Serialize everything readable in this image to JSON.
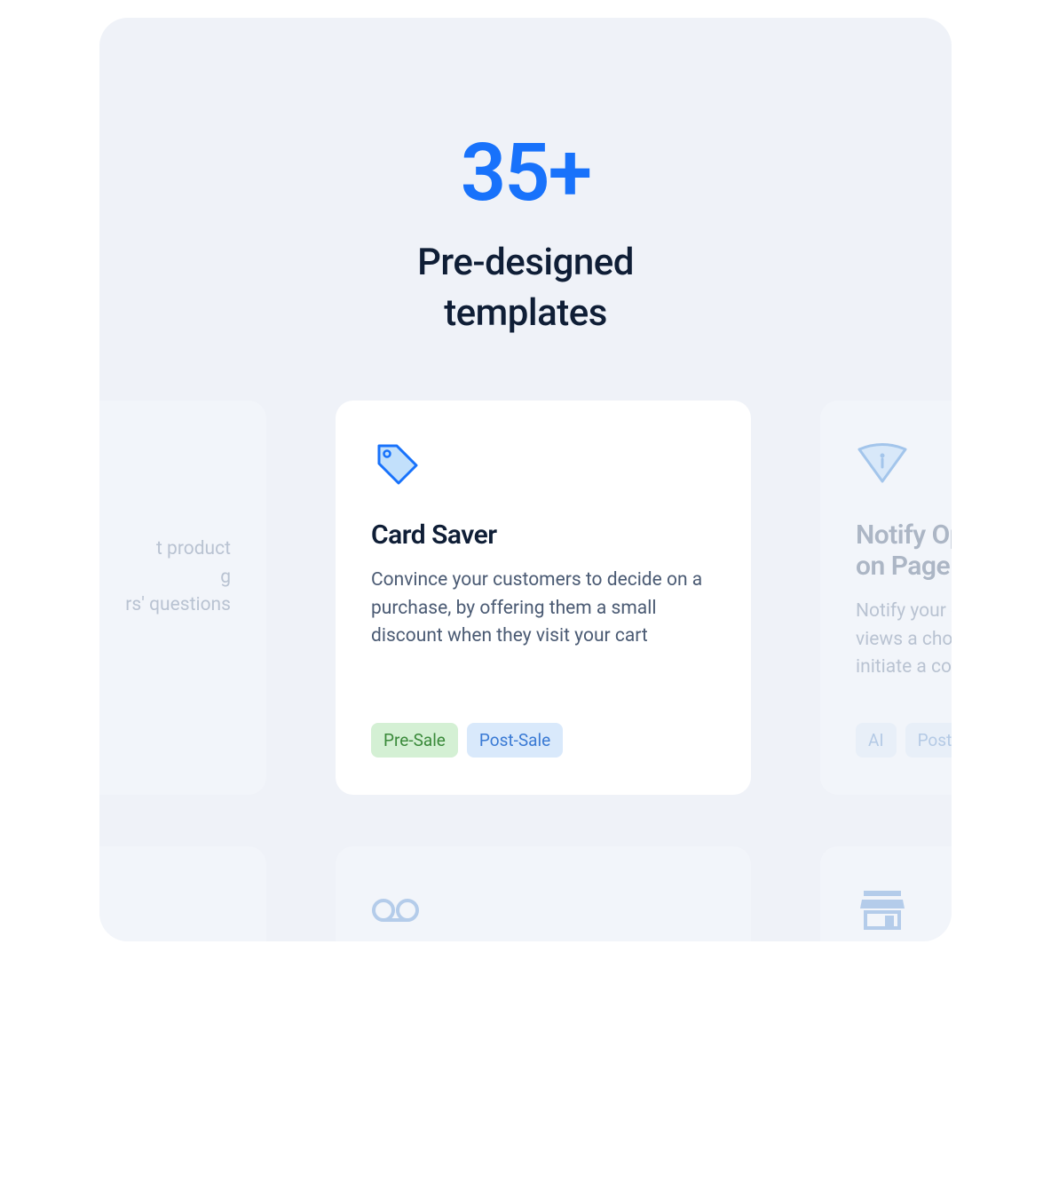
{
  "hero": {
    "count": "35+",
    "subtitle_line1": "Pre-designed",
    "subtitle_line2": "templates"
  },
  "cards": [
    {
      "title": "",
      "description": "...t product\n...g\n...rs' questions",
      "tags": []
    },
    {
      "title": "Card Saver",
      "description": "Convince your customers to decide on a purchase, by offering them a small discount when they visit your cart",
      "tags": [
        {
          "label": "Pre-Sale",
          "type": "green"
        },
        {
          "label": "Post-Sale",
          "type": "blue"
        }
      ]
    },
    {
      "title": "Notify Op... on Page",
      "description": "Notify your o... views a chose... initiate a con...",
      "tags": [
        {
          "label": "AI",
          "type": "blue"
        },
        {
          "label": "Post-Sale",
          "type": "blue"
        }
      ]
    }
  ]
}
